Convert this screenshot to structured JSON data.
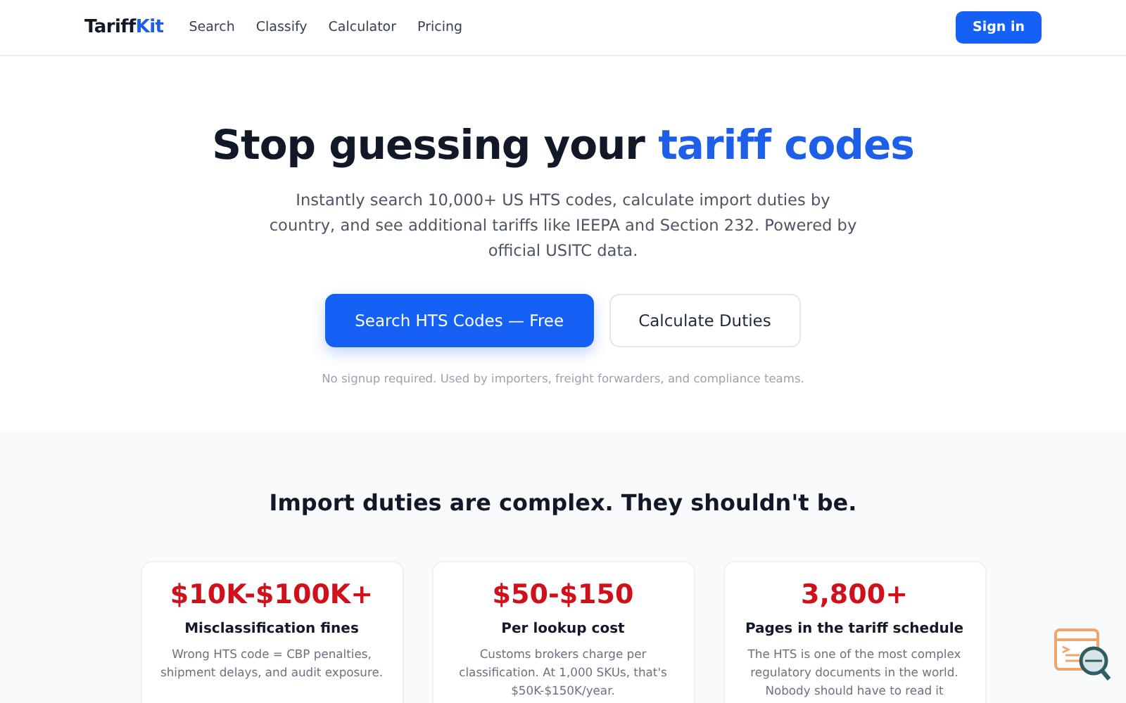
{
  "nav": {
    "logo": {
      "text": "Tariff",
      "accent": "Kit"
    },
    "links": [
      "Search",
      "Classify",
      "Calculator",
      "Pricing"
    ],
    "signin": "Sign in"
  },
  "hero": {
    "title": "Stop guessing your ",
    "title_accent": "tariff codes",
    "subtitle": "Instantly search 10,000+ US HTS codes, calculate import duties by country, and see additional tariffs like IEEPA and Section 232. Powered by official USITC data.",
    "buttons": [
      {
        "label": "Search HTS Codes — Free",
        "kind": "primary"
      },
      {
        "label": "Calculate Duties",
        "kind": "secondary"
      }
    ],
    "note": "No signup required. Used by importers, freight forwarders, and compliance teams."
  },
  "problems": {
    "heading": "Import duties are complex. They shouldn't be.",
    "cards": [
      {
        "stat": "$10K-$100K+",
        "title": "Misclassification fines",
        "text": "Wrong HTS code = CBP penalties, shipment delays, and audit exposure."
      },
      {
        "stat": "$50-$150",
        "title": "Per lookup cost",
        "text": "Customs brokers charge per classification. At 1,000 SKUs, that's $50K-$150K/year."
      },
      {
        "stat": "3,800+",
        "title": "Pages in the tariff schedule",
        "text": "The HTS is one of the most complex regulatory documents in the world. Nobody should have to read it"
      }
    ]
  }
}
